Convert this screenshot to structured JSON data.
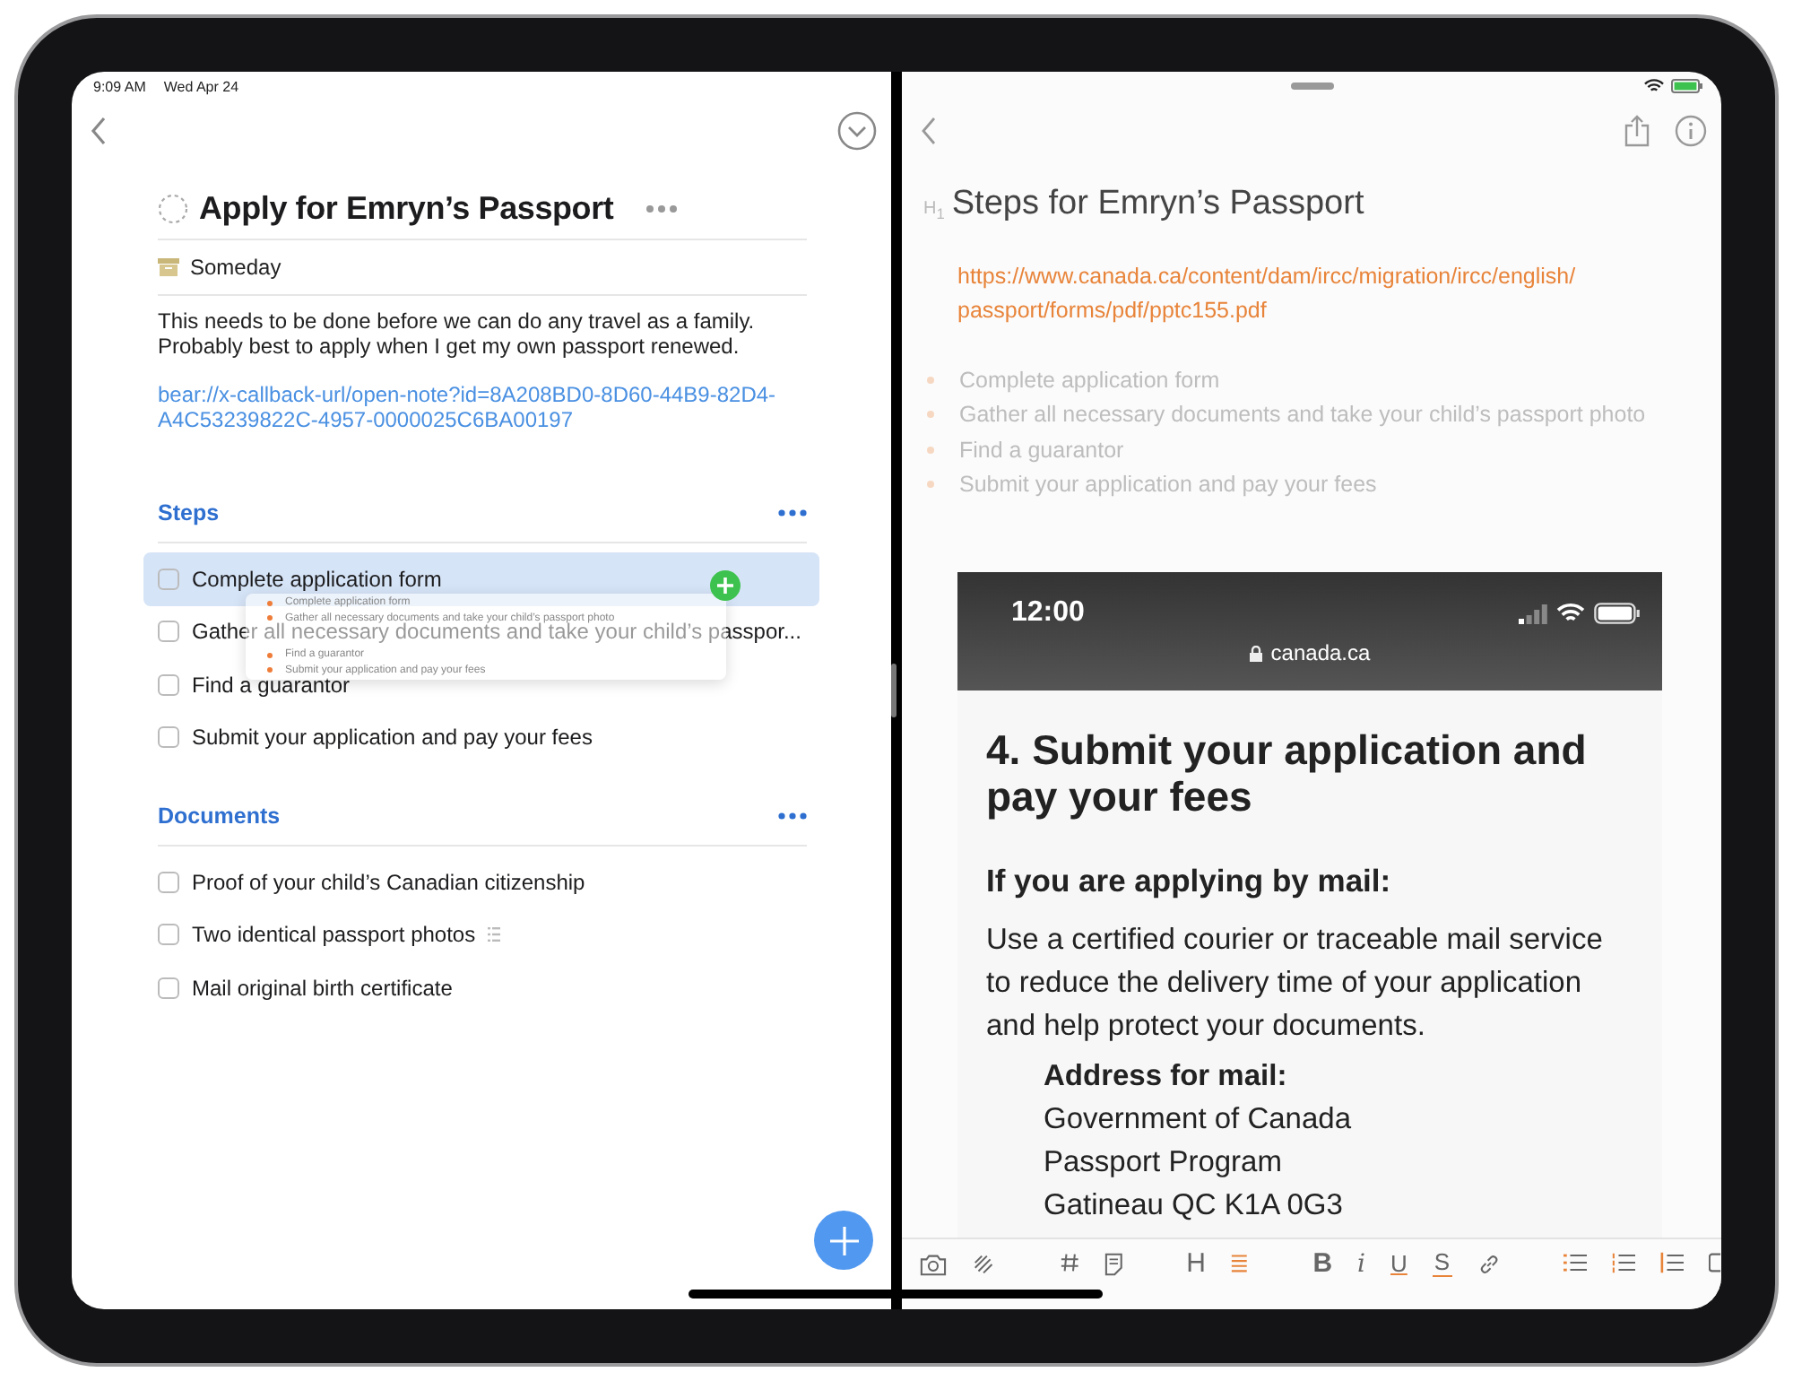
{
  "status_bar": {
    "time": "9:09 AM",
    "date": "Wed Apr 24"
  },
  "project": {
    "title": "Apply for Emryn’s Passport",
    "when": "Someday",
    "notes": "This needs to be done before we can do any travel as a family.\nProbably best to apply when I get my own passport renewed.",
    "link": "bear://x-callback-url/open-note?id=8A208BD0-8D60-44B9-82D4-A4C53239822C-4957-0000025C6BA00197"
  },
  "headings": [
    {
      "title": "Steps",
      "items": [
        {
          "label": "Complete application form",
          "checked": false,
          "highlighted": true,
          "has_notes": false
        },
        {
          "label": "Gather all necessary documents and take your child’s passpor...",
          "checked": false,
          "highlighted": false,
          "has_notes": false
        },
        {
          "label": "Find a guarantor",
          "checked": false,
          "highlighted": false,
          "has_notes": false
        },
        {
          "label": "Submit your application and pay your fees",
          "checked": false,
          "highlighted": false,
          "has_notes": false
        }
      ]
    },
    {
      "title": "Documents",
      "items": [
        {
          "label": "Proof of your child’s Canadian citizenship",
          "checked": false,
          "highlighted": false,
          "has_notes": false
        },
        {
          "label": "Two identical passport photos",
          "checked": false,
          "highlighted": false,
          "has_notes": true
        },
        {
          "label": "Mail original birth certificate",
          "checked": false,
          "highlighted": false,
          "has_notes": false
        }
      ]
    }
  ],
  "drag_preview": {
    "items": [
      "Complete application form",
      "Gather all necessary documents and take your child’s passport photo",
      "Find a guarantor",
      "Submit your application and pay your fees"
    ]
  },
  "note": {
    "heading_marker": "H$_{1}$",
    "title": "Steps for Emryn’s Passport",
    "url": "https://www.canada.ca/content/dam/ircc/migration/ircc/english/passport/forms/pdf/pptc155.pdf",
    "bullets": [
      "Complete application form",
      "Gather all necessary documents and take your child’s passport photo",
      "Find a guarantor",
      "Submit your application and pay your fees"
    ],
    "screenshot": {
      "time": "12:00",
      "address": "canada.ca",
      "heading": "4. Submit your application and pay your fees",
      "subheading": "If you are applying by mail:",
      "body": "Use a certified courier or traceable mail service to reduce the delivery time of your application and help protect your documents.",
      "address_label": "Address for mail:",
      "address_lines": [
        "Government of Canada",
        "Passport Program",
        "Gatineau QC  K1A 0G3"
      ]
    }
  },
  "format_toolbar": {
    "glyphs": [
      "H",
      "B",
      "i",
      "U",
      "S"
    ]
  }
}
